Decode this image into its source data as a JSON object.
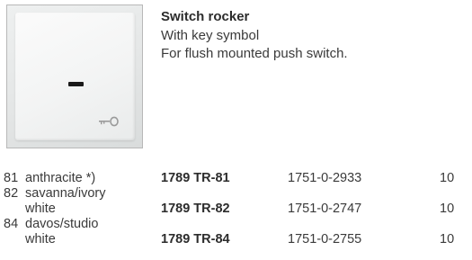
{
  "product": {
    "title": "Switch rocker",
    "description": [
      "With key symbol",
      "For flush mounted push switch."
    ],
    "image": {
      "subject": "white square switch rocker with dark indicator window and key symbol",
      "icon": "key-icon"
    }
  },
  "table": {
    "rows": [
      {
        "code": "81",
        "name_lines": [
          "anthracite *)"
        ],
        "type": "1789 TR-81",
        "order_no": "1751-0-2933",
        "qty": "10"
      },
      {
        "code": "82",
        "name_lines": [
          "savanna/ivory",
          "white"
        ],
        "type": "1789 TR-82",
        "order_no": "1751-0-2747",
        "qty": "10"
      },
      {
        "code": "84",
        "name_lines": [
          "davos/studio",
          "white"
        ],
        "type": "1789 TR-84",
        "order_no": "1751-0-2755",
        "qty": "10"
      }
    ]
  },
  "colors": {
    "text": "#3a3a3a",
    "heading": "#2c2c2c",
    "frame_border": "#b8b8b8",
    "indicator": "#1a1a1a"
  }
}
